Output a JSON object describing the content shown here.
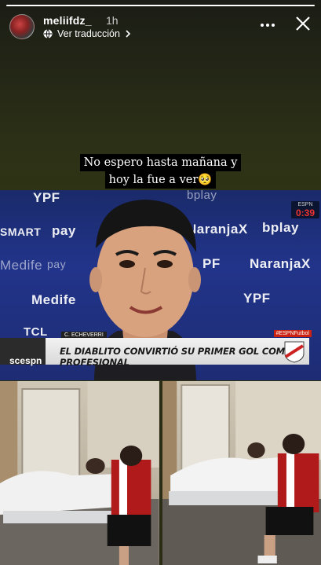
{
  "story": {
    "username": "meliifdz_",
    "time_ago": "1h",
    "translate_label": "Ver traducción",
    "progress_fraction": 1.0
  },
  "caption": {
    "line1": "No espero hasta mañana y",
    "line2": "hoy la fue a ver🥺"
  },
  "video": {
    "sponsors": [
      "YPF",
      "bplay",
      "SMART",
      "pay",
      "NaranjaX",
      "Medife",
      "TCL",
      "ESPN"
    ],
    "live_label": "ESPN",
    "live_time": "0:39",
    "player_name": "C. ECHEVERRI",
    "headline": "EL DIABLITO CONVIRTIÓ SU PRIMER GOL COMO PROFESIONAL",
    "network": "scespn",
    "hashtag": "#ESPNFutbol"
  },
  "colors": {
    "accent": "#ffffff",
    "backdrop": "#2f3315",
    "river_red": "#cc2222"
  }
}
